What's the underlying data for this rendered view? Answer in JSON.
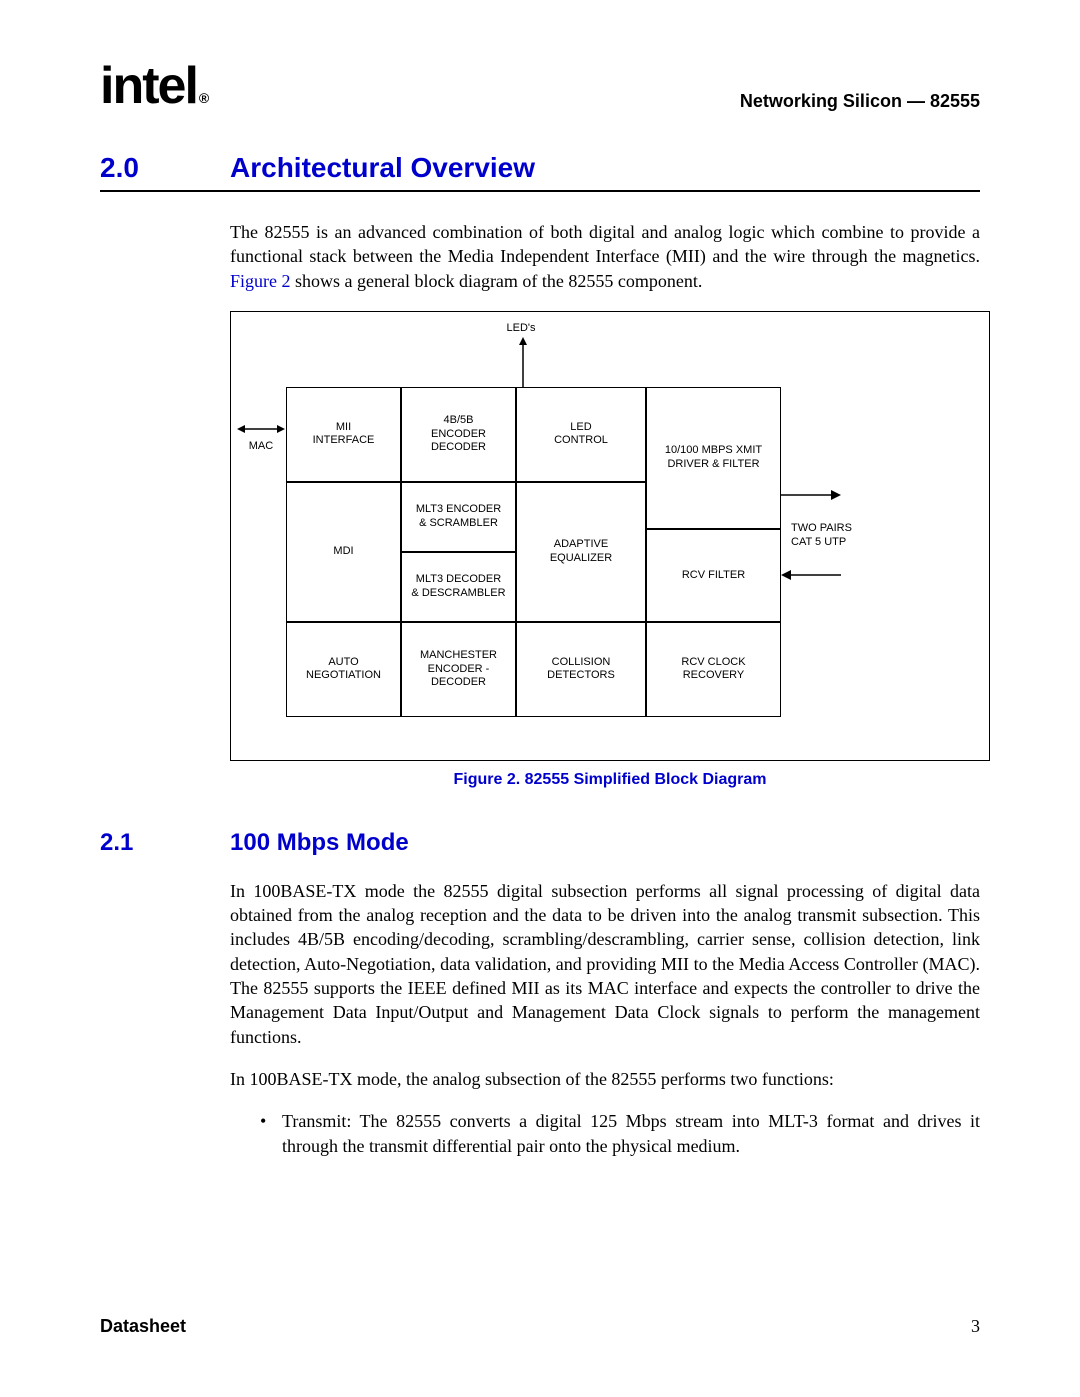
{
  "header": {
    "logo_text": "intel",
    "logo_reg": "®",
    "doc_title": "Networking Silicon — 82555"
  },
  "section1": {
    "num": "2.0",
    "title": "Architectural Overview",
    "para1_a": "The 82555 is an advanced combination of both digital and analog logic which combine to provide a functional stack between the Media Independent Interface (MII) and the wire through the magnetics. ",
    "figref": "Figure 2",
    "para1_b": " shows a general block diagram of the 82555 component."
  },
  "figure": {
    "caption": "Figure 2. 82555 Simplified Block Diagram",
    "leds": "LED's",
    "mac": "MAC",
    "two_pairs": "TWO PAIRS\nCAT 5 UTP",
    "blocks": {
      "mii_interface": "MII\nINTERFACE",
      "encoder_4b5b": "4B/5B\nENCODER\nDECODER",
      "led_control": "LED\nCONTROL",
      "xmit": "10/100 MBPS XMIT\nDRIVER & FILTER",
      "mdi": "MDI",
      "mlt3_enc": "MLT3 ENCODER\n& SCRAMBLER",
      "adaptive_eq": "ADAPTIVE\nEQUALIZER",
      "mlt3_dec": "MLT3 DECODER\n& DESCRAMBLER",
      "rcv_filter": "RCV FILTER",
      "auto_neg": "AUTO\nNEGOTIATION",
      "manchester": "MANCHESTER\nENCODER -\nDECODER",
      "collision": "COLLISION\nDETECTORS",
      "rcv_clock": "RCV CLOCK\nRECOVERY"
    }
  },
  "section2": {
    "num": "2.1",
    "title": "100 Mbps Mode",
    "para1": "In 100BASE-TX mode the 82555 digital subsection performs all signal processing of digital data obtained from the analog reception and the data to be driven into the analog transmit subsection. This includes 4B/5B encoding/decoding, scrambling/descrambling, carrier sense, collision detection, link detection, Auto-Negotiation, data validation, and providing MII to the Media Access Controller (MAC). The 82555 supports the IEEE defined MII as its MAC interface and expects the controller to drive the Management Data Input/Output and Management Data Clock signals to perform the management functions.",
    "para2": "In 100BASE-TX mode, the analog subsection of the 82555 performs two functions:",
    "bullet1": "Transmit: The 82555 converts a digital 125 Mbps stream into MLT-3 format and drives it through the transmit differential pair onto the physical medium."
  },
  "footer": {
    "left": "Datasheet",
    "page": "3"
  }
}
